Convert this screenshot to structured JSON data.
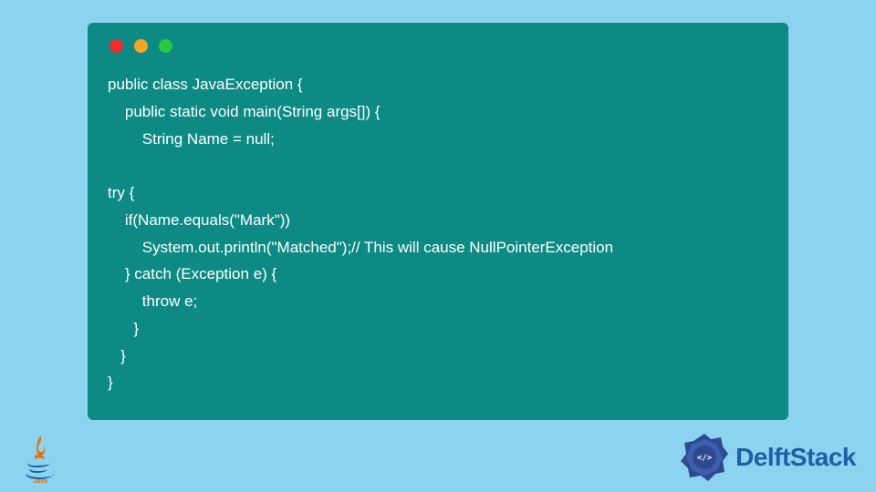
{
  "code": {
    "lines": [
      "public class JavaException {",
      "    public static void main(String args[]) {",
      "        String Name = null;",
      "",
      "try {",
      "    if(Name.equals(\"Mark\"))",
      "        System.out.println(\"Matched\");// This will cause NullPointerException",
      "    } catch (Exception e) {",
      "        throw e;",
      "      }",
      "   }",
      "}"
    ]
  },
  "branding": {
    "java_label": "Java",
    "site_name": "DelftStack"
  },
  "colors": {
    "background": "#8bd3ef",
    "window": "#0e8a84",
    "text": "#ffffff",
    "brand_blue": "#1e5fa8"
  }
}
